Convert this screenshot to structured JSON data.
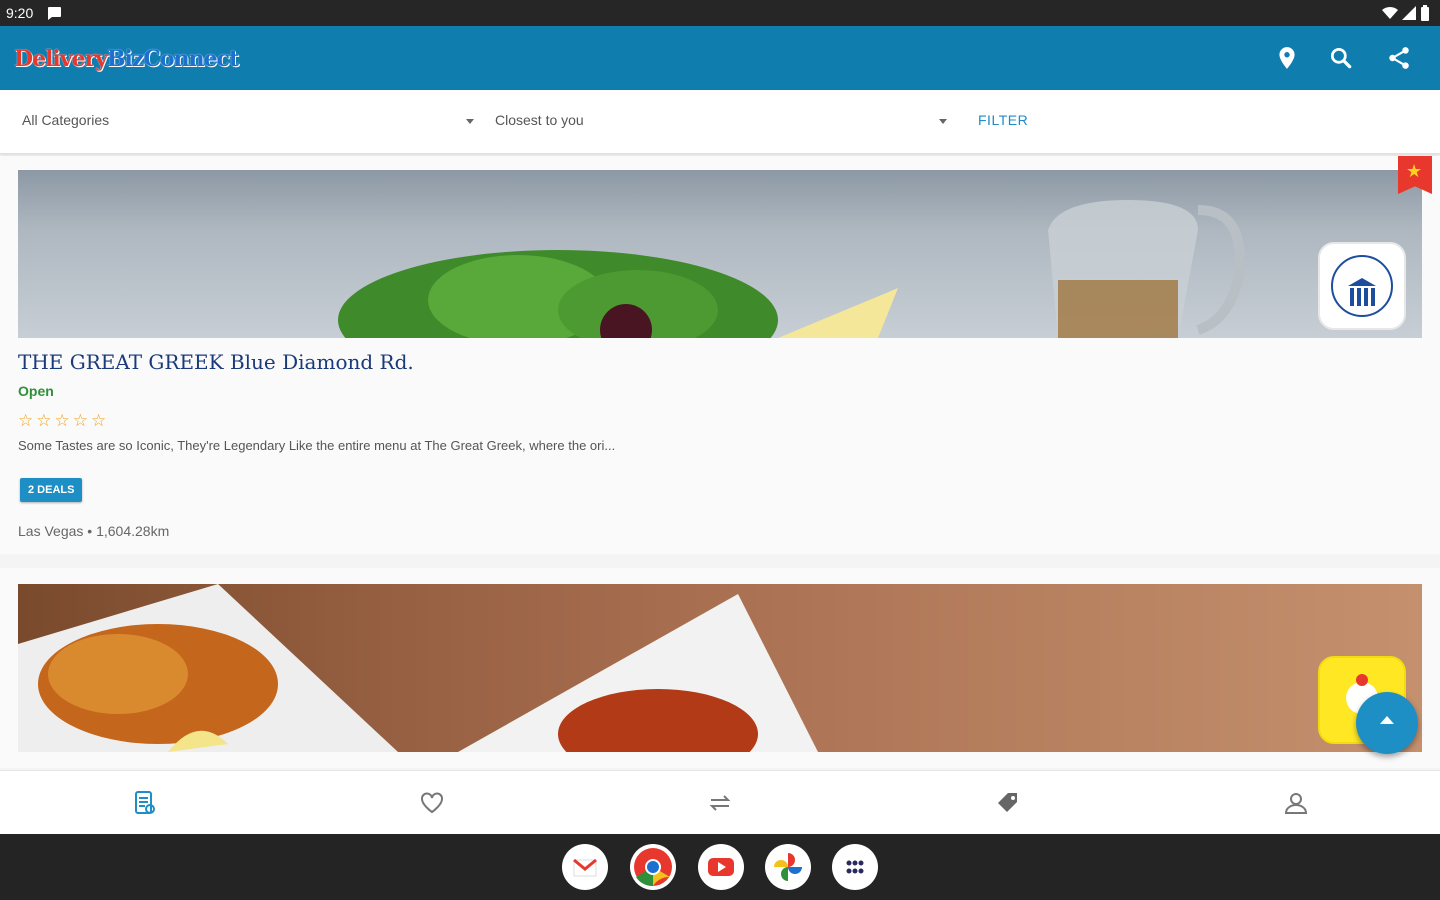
{
  "statusbar": {
    "time": "9:20",
    "icons": [
      "chat-icon",
      "wifi-icon",
      "signal-icon",
      "battery-icon"
    ]
  },
  "appbar": {
    "logo_part1": "Delivery",
    "logo_part2": "BizConnect",
    "actions": [
      "location-pin-icon",
      "search-icon",
      "share-icon"
    ]
  },
  "filters": {
    "category": "All Categories",
    "sort": "Closest to you",
    "filter_button": "FILTER"
  },
  "listings": [
    {
      "title": "THE GREAT GREEK Blue Diamond Rd.",
      "status": "Open",
      "rating_stars": "☆☆☆☆☆",
      "description": "Some Tastes are so Iconic, They're Legendary Like the entire menu at The Great Greek, where the ori...",
      "deals": "2 DEALS",
      "location": "Las Vegas • 1,604.28km",
      "featured": true
    },
    {
      "featured": false
    }
  ],
  "colors": {
    "primary": "#0f7eaf",
    "accent": "#1e8fc4",
    "open": "#2f8f3a",
    "star": "#f0a21a",
    "ribbon": "#e8382e"
  },
  "bottom_nav": [
    "listings-icon",
    "favorites-icon",
    "transfer-icon",
    "deals-tag-icon",
    "profile-icon"
  ],
  "dock_apps": [
    "gmail-icon",
    "chrome-icon",
    "youtube-icon",
    "photos-icon",
    "app-drawer-icon"
  ]
}
